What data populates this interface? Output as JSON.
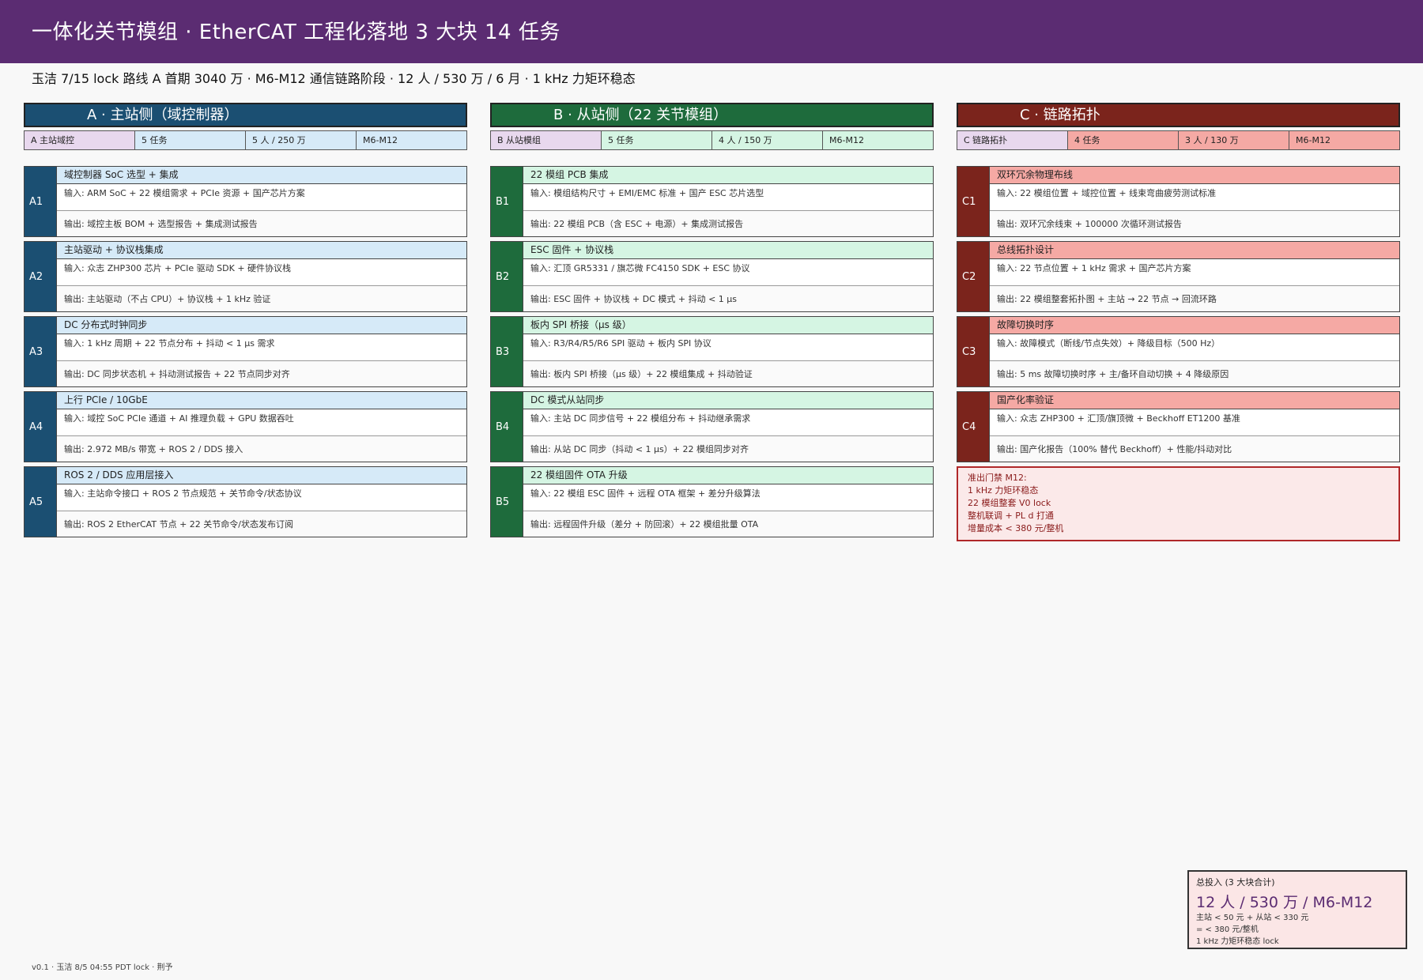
{
  "header": {
    "title": "一体化关节模组 · EtherCAT 工程化落地 3 大块 14 任务",
    "subtitle": "玉洁 7/15 lock 路线 A 首期 3040 万 · M6-M12 通信链路阶段 · 12 人 / 530 万 / 6 月 · 1 kHz 力矩环稳态"
  },
  "colors": {
    "header_bg": "#5b2c72",
    "A_dark": "#1b4f72",
    "A_light": "#d6eaf8",
    "B_dark": "#1e6b3c",
    "B_light": "#d5f5e3",
    "C_dark": "#7b241c",
    "C_light": "#f5a9a4"
  },
  "columns": [
    {
      "key": "A",
      "header": "A · 主站侧（域控制器）",
      "meta": [
        "A 主站域控",
        "5 任务",
        "5 人 / 250 万",
        "M6-M12"
      ],
      "tasks": [
        {
          "id": "A1",
          "title": "域控制器 SoC 选型 + 集成",
          "input": "输入: ARM SoC + 22 模组需求 + PCIe 资源 + 国产芯片方案",
          "output": "输出: 域控主板 BOM + 选型报告 + 集成测试报告"
        },
        {
          "id": "A2",
          "title": "主站驱动 + 协议栈集成",
          "input": "输入: 众志 ZHP300 芯片 + PCIe 驱动 SDK + 硬件协议栈",
          "output": "输出: 主站驱动（不占 CPU）+ 协议栈 + 1 kHz 验证"
        },
        {
          "id": "A3",
          "title": "DC 分布式时钟同步",
          "input": "输入: 1 kHz 周期 + 22 节点分布 + 抖动 < 1 μs 需求",
          "output": "输出: DC 同步状态机 + 抖动测试报告 + 22 节点同步对齐"
        },
        {
          "id": "A4",
          "title": "上行 PCIe / 10GbE",
          "input": "输入: 域控 SoC PCIe 通道 + AI 推理负载 + GPU 数据吞吐",
          "output": "输出: 2.972 MB/s 带宽 + ROS 2 / DDS 接入"
        },
        {
          "id": "A5",
          "title": "ROS 2 / DDS 应用层接入",
          "input": "输入: 主站命令接口 + ROS 2 节点规范 + 关节命令/状态协议",
          "output": "输出: ROS 2 EtherCAT 节点 + 22 关节命令/状态发布订阅"
        }
      ]
    },
    {
      "key": "B",
      "header": "B · 从站侧（22 关节模组）",
      "meta": [
        "B 从站模组",
        "5 任务",
        "4 人 / 150 万",
        "M6-M12"
      ],
      "tasks": [
        {
          "id": "B1",
          "title": "22 模组 PCB 集成",
          "input": "输入: 模组结构尺寸 + EMI/EMC 标准 + 国产 ESC 芯片选型",
          "output": "输出: 22 模组 PCB（含 ESC + 电源）+ 集成测试报告"
        },
        {
          "id": "B2",
          "title": "ESC 固件 + 协议栈",
          "input": "输入: 汇顶 GR5331 / 旗芯微 FC4150 SDK + ESC 协议",
          "output": "输出: ESC 固件 + 协议栈 + DC 模式 + 抖动 < 1 μs"
        },
        {
          "id": "B3",
          "title": "板内 SPI 桥接（μs 级）",
          "input": "输入: R3/R4/R5/R6 SPI 驱动 + 板内 SPI 协议",
          "output": "输出: 板内 SPI 桥接（μs 级）+ 22 模组集成 + 抖动验证"
        },
        {
          "id": "B4",
          "title": "DC 模式从站同步",
          "input": "输入: 主站 DC 同步信号 + 22 模组分布 + 抖动继承需求",
          "output": "输出: 从站 DC 同步（抖动 < 1 μs）+ 22 模组同步对齐"
        },
        {
          "id": "B5",
          "title": "22 模组固件 OTA 升级",
          "input": "输入: 22 模组 ESC 固件 + 远程 OTA 框架 + 差分升级算法",
          "output": "输出: 远程固件升级（差分 + 防回滚）+ 22 模组批量 OTA"
        }
      ]
    },
    {
      "key": "C",
      "header": "C · 链路拓扑",
      "meta": [
        "C 链路拓扑",
        "4 任务",
        "3 人 / 130 万",
        "M6-M12"
      ],
      "tasks": [
        {
          "id": "C1",
          "title": "双环冗余物理布线",
          "input": "输入: 22 模组位置 + 域控位置 + 线束弯曲疲劳测试标准",
          "output": "输出: 双环冗余线束 + 100000 次循环测试报告"
        },
        {
          "id": "C2",
          "title": "总线拓扑设计",
          "input": "输入: 22 节点位置 + 1 kHz 需求 + 国产芯片方案",
          "output": "输出: 22 模组整套拓扑图 + 主站 → 22 节点 → 回流环路"
        },
        {
          "id": "C3",
          "title": "故障切换时序",
          "input": "输入: 故障模式（断线/节点失效）+ 降级目标（500 Hz）",
          "output": "输出: 5 ms 故障切换时序 + 主/备环自动切换 + 4 降级原因"
        },
        {
          "id": "C4",
          "title": "国产化率验证",
          "input": "输入: 众志 ZHP300 + 汇顶/旗顶微 + Beckhoff ET1200 基准",
          "output": "输出: 国产化报告（100% 替代 Beckhoff）+ 性能/抖动对比"
        }
      ],
      "gate": {
        "title": "准出门禁 M12:",
        "lines": [
          "1 kHz 力矩环稳态",
          "22 模组整套 V0 lock",
          "整机联调 + PL d 打通",
          "增量成本 < 380 元/整机"
        ]
      }
    }
  ],
  "summary": {
    "label": "总投入 (3 大块合计)",
    "main": "12 人 / 530 万 / M6-M12",
    "lines": [
      "主站 < 50 元 + 从站 < 330 元",
      "= < 380 元/整机",
      "1 kHz 力矩环稳态 lock"
    ]
  },
  "footer": "v0.1 · 玉洁 8/5 04:55 PDT lock · 荆予"
}
